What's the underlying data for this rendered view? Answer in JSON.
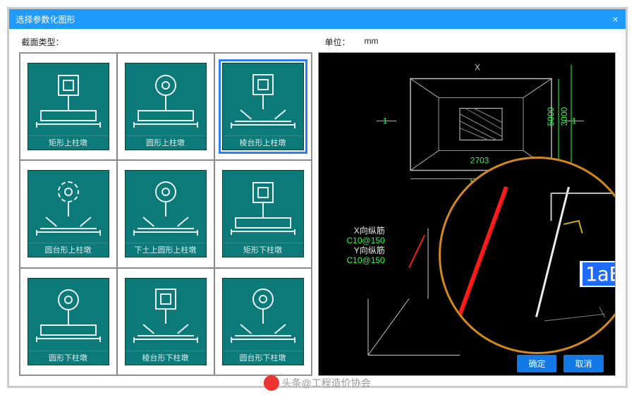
{
  "window": {
    "title": "选择参数化图形",
    "close": "×"
  },
  "labels": {
    "section_type": "截面类型：",
    "unit": "单位：",
    "unit_value": "mm"
  },
  "tiles": [
    {
      "name": "rect-top-pier",
      "caption": "矩形上柱墩",
      "topShape": "square",
      "base": "rect",
      "selected": false
    },
    {
      "name": "circle-top-pier",
      "caption": "圆形上柱墩",
      "topShape": "circle",
      "base": "rect",
      "selected": false
    },
    {
      "name": "frustum-top-pier",
      "caption": "棱台形上柱墩",
      "topShape": "square",
      "base": "trap",
      "selected": true
    },
    {
      "name": "cone-top-pier",
      "caption": "圆台形上柱墩",
      "topShape": "circle-dashed",
      "base": "trap",
      "selected": false
    },
    {
      "name": "bottom-cone-pier",
      "caption": "下土上圆形上柱墩",
      "topShape": "circle",
      "base": "trap",
      "selected": false
    },
    {
      "name": "rect-bottom-pier",
      "caption": "矩形下柱墩",
      "topShape": "square",
      "base": "rect",
      "selected": false
    },
    {
      "name": "circle-bottom-pier",
      "caption": "圆形下柱墩",
      "topShape": "circle",
      "base": "rect",
      "selected": false
    },
    {
      "name": "frustum-bottom-pier",
      "caption": "棱台形下柱墩",
      "topShape": "square",
      "base": "trap",
      "selected": false
    },
    {
      "name": "cone-bottom-pier",
      "caption": "圆台形下柱墩",
      "topShape": "circle",
      "base": "trap",
      "selected": false
    }
  ],
  "preview": {
    "dims": {
      "X": "X",
      "one_left": "1",
      "one_right": "1",
      "w": "5000",
      "w_inner": "2703",
      "h": "5000",
      "h_outer": "3000"
    },
    "rebar": {
      "x_label": "X向纵筋",
      "x_val": "C10@150",
      "y_label": "Y向纵筋",
      "y_val": "C10@150"
    },
    "magnifier_text": "1aE"
  },
  "buttons": {
    "ok": "确定",
    "cancel": "取消"
  },
  "watermark": "头条@工程造价协会"
}
